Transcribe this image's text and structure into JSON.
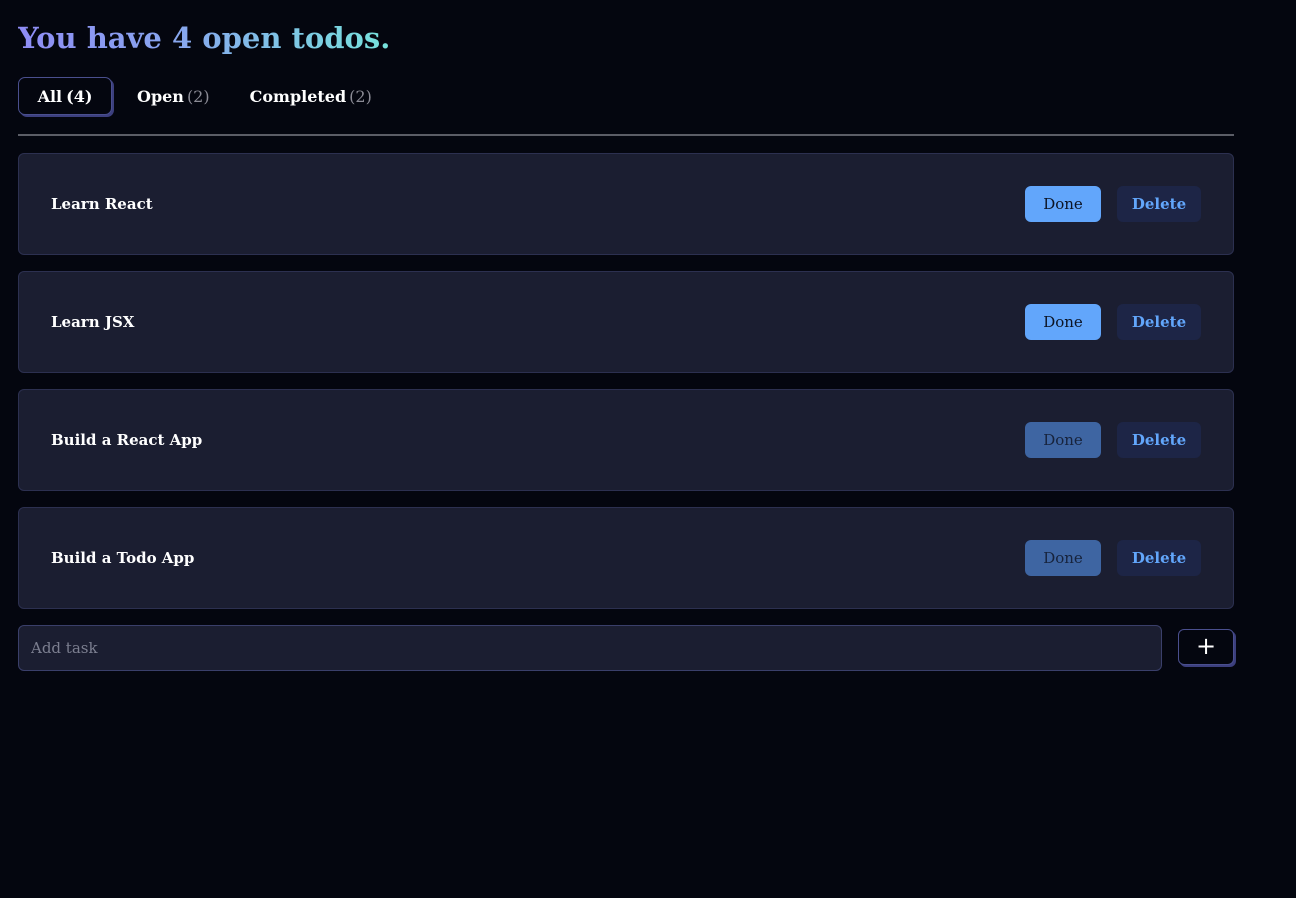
{
  "header": {
    "title": "You have 4 open todos."
  },
  "tabs": [
    {
      "label": "All",
      "count": "(4)",
      "active": true
    },
    {
      "label": "Open",
      "count": "(2)",
      "active": false
    },
    {
      "label": "Completed",
      "count": "(2)",
      "active": false
    }
  ],
  "todos": [
    {
      "text": "Learn React",
      "done_label": "Done",
      "delete_label": "Delete",
      "completed": false
    },
    {
      "text": "Learn JSX",
      "done_label": "Done",
      "delete_label": "Delete",
      "completed": false
    },
    {
      "text": "Build a React App",
      "done_label": "Done",
      "delete_label": "Delete",
      "completed": true
    },
    {
      "text": "Build a Todo App",
      "done_label": "Done",
      "delete_label": "Delete",
      "completed": true
    }
  ],
  "add_task": {
    "placeholder": "Add task",
    "value": "",
    "button_icon": "plus-icon",
    "button_label": "+"
  },
  "colors": {
    "background": "#04060f",
    "card": "#1b1e31",
    "accent": "#62a6fb",
    "done_completed": "#3e65a2",
    "title_gradient_start": "#8f8cf5",
    "title_gradient_end": "#76e3dc"
  }
}
